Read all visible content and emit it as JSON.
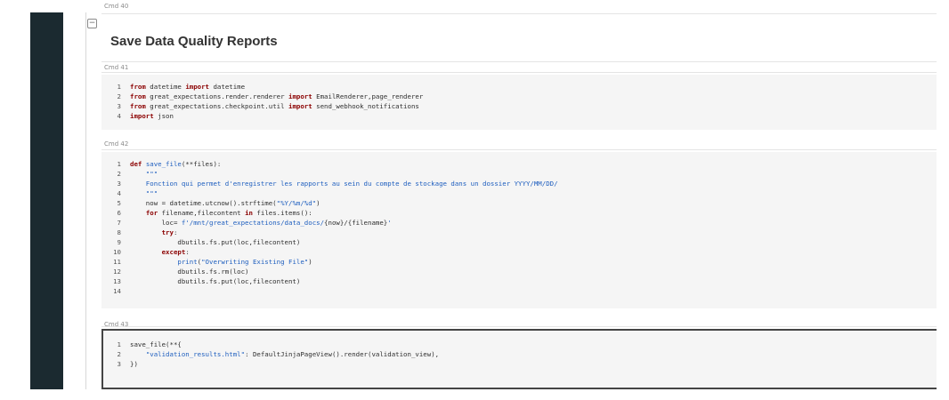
{
  "cells": [
    {
      "cmd": "Cmd 40",
      "title": "Save Data Quality Reports"
    },
    {
      "cmd": "Cmd 41",
      "lines": [
        [
          [
            "1",
            "ln"
          ],
          [
            "from",
            "kw"
          ],
          [
            " datetime ",
            ""
          ],
          [
            "import",
            "kw"
          ],
          [
            " datetime",
            ""
          ]
        ],
        [
          [
            "2",
            "ln"
          ],
          [
            "from",
            "kw"
          ],
          [
            " great_expectations.render.renderer ",
            ""
          ],
          [
            "import",
            "kw"
          ],
          [
            " EmailRenderer,page_renderer",
            ""
          ]
        ],
        [
          [
            "3",
            "ln"
          ],
          [
            "from",
            "kw"
          ],
          [
            " great_expectations.checkpoint.util ",
            ""
          ],
          [
            "import",
            "kw"
          ],
          [
            " send_webhook_notifications",
            ""
          ]
        ],
        [
          [
            "4",
            "ln"
          ],
          [
            "import",
            "kw"
          ],
          [
            " json",
            ""
          ]
        ]
      ]
    },
    {
      "cmd": "Cmd 42",
      "lines": [
        [
          [
            "1",
            "ln"
          ],
          [
            "def",
            "kw"
          ],
          [
            " ",
            ""
          ],
          [
            "save_file",
            "fn"
          ],
          [
            "(**files):",
            ""
          ]
        ],
        [
          [
            "2",
            "ln"
          ],
          [
            "    \"\"\"",
            "str"
          ]
        ],
        [
          [
            "3",
            "ln"
          ],
          [
            "    Fonction qui permet d'enregistrer les rapports au sein du compte de stockage dans un dossier YYYY/MM/DD/",
            "str"
          ]
        ],
        [
          [
            "4",
            "ln"
          ],
          [
            "    \"\"\"",
            "str"
          ]
        ],
        [
          [
            "5",
            "ln"
          ],
          [
            "    now = datetime.utcnow().strftime(",
            ""
          ],
          [
            "\"%Y/%m/%d\"",
            "str"
          ],
          [
            ")",
            ""
          ]
        ],
        [
          [
            "6",
            "ln"
          ],
          [
            "    ",
            ""
          ],
          [
            "for",
            "kw"
          ],
          [
            " filename,filecontent ",
            ""
          ],
          [
            "in",
            "kw"
          ],
          [
            " files.items():",
            ""
          ]
        ],
        [
          [
            "7",
            "ln"
          ],
          [
            "        loc= ",
            ""
          ],
          [
            "f'/mnt/great_expectations/data_docs/",
            "str"
          ],
          [
            "{now}/{filename}",
            ""
          ],
          [
            "'",
            "str"
          ]
        ],
        [
          [
            "8",
            "ln"
          ],
          [
            "        ",
            ""
          ],
          [
            "try",
            "kw"
          ],
          [
            ":",
            ""
          ]
        ],
        [
          [
            "9",
            "ln"
          ],
          [
            "            dbutils.fs.put(loc,filecontent)",
            ""
          ]
        ],
        [
          [
            "10",
            "ln"
          ],
          [
            "        ",
            ""
          ],
          [
            "except",
            "kw"
          ],
          [
            ":",
            ""
          ]
        ],
        [
          [
            "11",
            "ln"
          ],
          [
            "            ",
            ""
          ],
          [
            "print",
            "fn"
          ],
          [
            "(",
            ""
          ],
          [
            "\"Overwriting Existing File\"",
            "str"
          ],
          [
            ")",
            ""
          ]
        ],
        [
          [
            "12",
            "ln"
          ],
          [
            "            dbutils.fs.rm(loc)",
            ""
          ]
        ],
        [
          [
            "13",
            "ln"
          ],
          [
            "            dbutils.fs.put(loc,filecontent)",
            ""
          ]
        ],
        [
          [
            "14",
            "ln"
          ],
          [
            "",
            ""
          ]
        ]
      ]
    },
    {
      "cmd": "Cmd 43",
      "lines": [
        [
          [
            "1",
            "ln"
          ],
          [
            "save_file(**{",
            ""
          ]
        ],
        [
          [
            "2",
            "ln"
          ],
          [
            "    ",
            ""
          ],
          [
            "\"validation_results.html\"",
            "str"
          ],
          [
            ": DefaultJinjaPageView().render(validation_view),",
            ""
          ]
        ],
        [
          [
            "3",
            "ln"
          ],
          [
            "})",
            ""
          ]
        ]
      ]
    }
  ],
  "icons": {
    "collapse": "collapse-minus-icon",
    "collapse_glyph": "−"
  }
}
